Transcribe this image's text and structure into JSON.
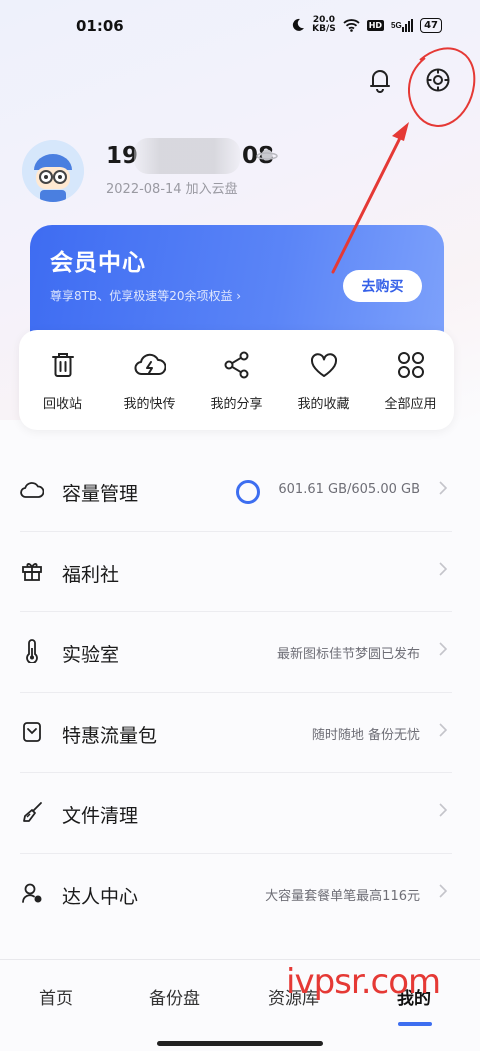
{
  "status_bar": {
    "time": "01:06",
    "net_speed": "20.0\nKB/S",
    "hd": "HD",
    "signal": "5G",
    "battery": "47"
  },
  "header": {
    "bell_icon": "bell-icon",
    "settings_icon": "settings-icon"
  },
  "profile": {
    "username_start": "19",
    "username_end": "08",
    "joined": "2022-08-14 加入云盘"
  },
  "vip": {
    "title": "会员中心",
    "subtitle": "尊享8TB、优享极速等20余项权益",
    "button": "去购买"
  },
  "quick_actions": [
    {
      "label": "回收站",
      "icon": "trash-icon"
    },
    {
      "label": "我的快传",
      "icon": "cloud-bolt-icon"
    },
    {
      "label": "我的分享",
      "icon": "share-icon"
    },
    {
      "label": "我的收藏",
      "icon": "heart-icon"
    },
    {
      "label": "全部应用",
      "icon": "apps-grid-icon"
    }
  ],
  "menu": [
    {
      "label": "容量管理",
      "right": "601.61 GB/605.00 GB",
      "icon": "cloud-icon",
      "usage_fraction": 0.994
    },
    {
      "label": "福利社",
      "right": "",
      "icon": "gift-icon"
    },
    {
      "label": "实验室",
      "right": "最新图标佳节梦圆已发布",
      "icon": "thermometer-icon"
    },
    {
      "label": "特惠流量包",
      "right": "随时随地 备份无忧",
      "icon": "data-pack-icon"
    },
    {
      "label": "文件清理",
      "right": "",
      "icon": "broom-icon"
    },
    {
      "label": "达人中心",
      "right": "大容量套餐单笔最高116元",
      "icon": "expert-user-icon"
    }
  ],
  "tabs": [
    {
      "label": "首页"
    },
    {
      "label": "备份盘"
    },
    {
      "label": "资源库"
    },
    {
      "label": "我的"
    }
  ],
  "watermark": "ivpsr.com",
  "colors": {
    "accent": "#3d6ef0",
    "vip_gradient_start": "#3e6cf2",
    "annotation_red": "#e53935"
  }
}
